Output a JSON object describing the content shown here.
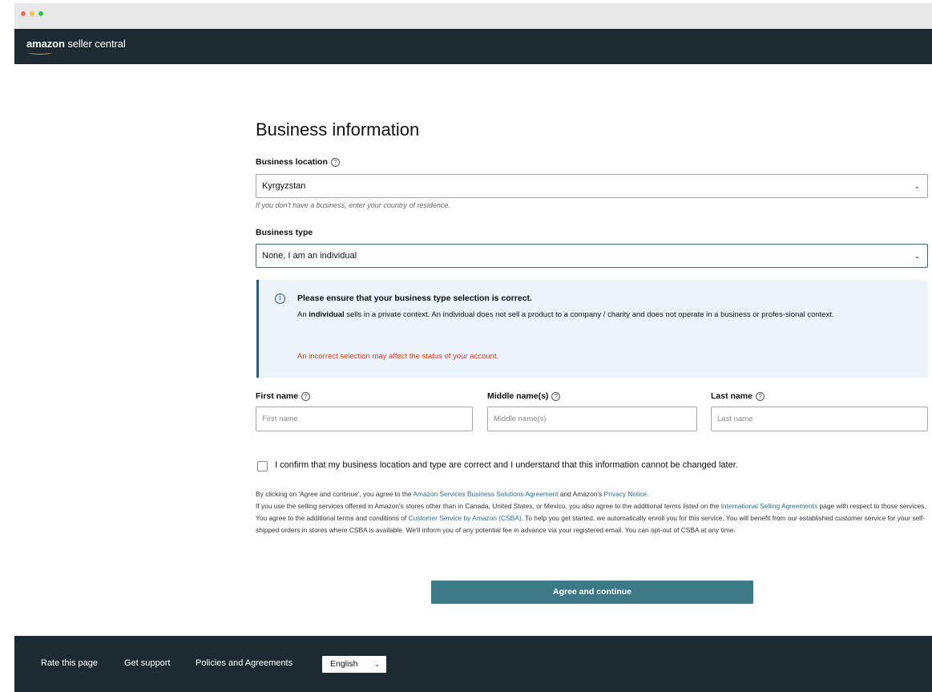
{
  "window": {
    "dot_colors": [
      "#f56a5f",
      "#f6be4f",
      "#2fc840"
    ]
  },
  "header": {
    "brand_bold": "amazon",
    "brand_rest": " seller central"
  },
  "form": {
    "title": "Business information",
    "business_location": {
      "label": "Business location",
      "value": "Kyrgyzstan",
      "hint": "If you don't have a business, enter your country of residence."
    },
    "business_type": {
      "label": "Business type",
      "value": "None, I am an individual"
    },
    "notice": {
      "heading": "Please ensure that your business type selection is correct.",
      "body_prefix": "An ",
      "body_bold": "individual",
      "body_suffix": " sells in a private context. An individual does not sell a product to a company / charity and does not operate in a business or profes-sional context.",
      "warning": "An incorrect selection may affect the status of your account."
    },
    "first_name": {
      "label": "First name",
      "placeholder": "First name"
    },
    "middle_name": {
      "label": "Middle name(s)",
      "placeholder": "Middle name(s)"
    },
    "last_name": {
      "label": "Last name",
      "placeholder": "Last name"
    },
    "confirm_label": "I confirm that my business location and type are correct and I understand that this information cannot be changed later.",
    "confirm_checked": false,
    "legal": {
      "p1_a": "By clicking on 'Agree and continue', you agree to the ",
      "p1_link1": "Amazon Services Business Solutions Agreement",
      "p1_b": " and Amazon's ",
      "p1_link2": "Privacy Notice",
      "p1_c": ".",
      "p2_a": "If you use the selling services offered in Amazon's stores other than in Canada, United States, or Mexico, you also agree to the additional terms listed on the ",
      "p2_link": "International Selling Agreements",
      "p2_b": " page with respect to those services.",
      "p3_a": "You agree to the additional terms and conditions of ",
      "p3_link": "Customer Service by Amazon (CSBA)",
      "p3_b": ". To help you get started, we automatically enroll you for this service. You will benefit from our established customer service for your self-shipped orders in stores where CSBA is available. We'll inform you of any potential fee in advance via your registered email. You can opt-out of CSBA at any time."
    },
    "submit_label": "Agree and continue"
  },
  "footer": {
    "rate_label": "Rate this page",
    "support_label": "Get support",
    "policies_label": "Policies and Agreements",
    "language": "English"
  },
  "colors": {
    "topbar": "#1b2b31",
    "button": "#3d7a88",
    "link": "#2c6e8c",
    "notice_bg": "#eaf4fa",
    "warning": "#c7401f"
  }
}
